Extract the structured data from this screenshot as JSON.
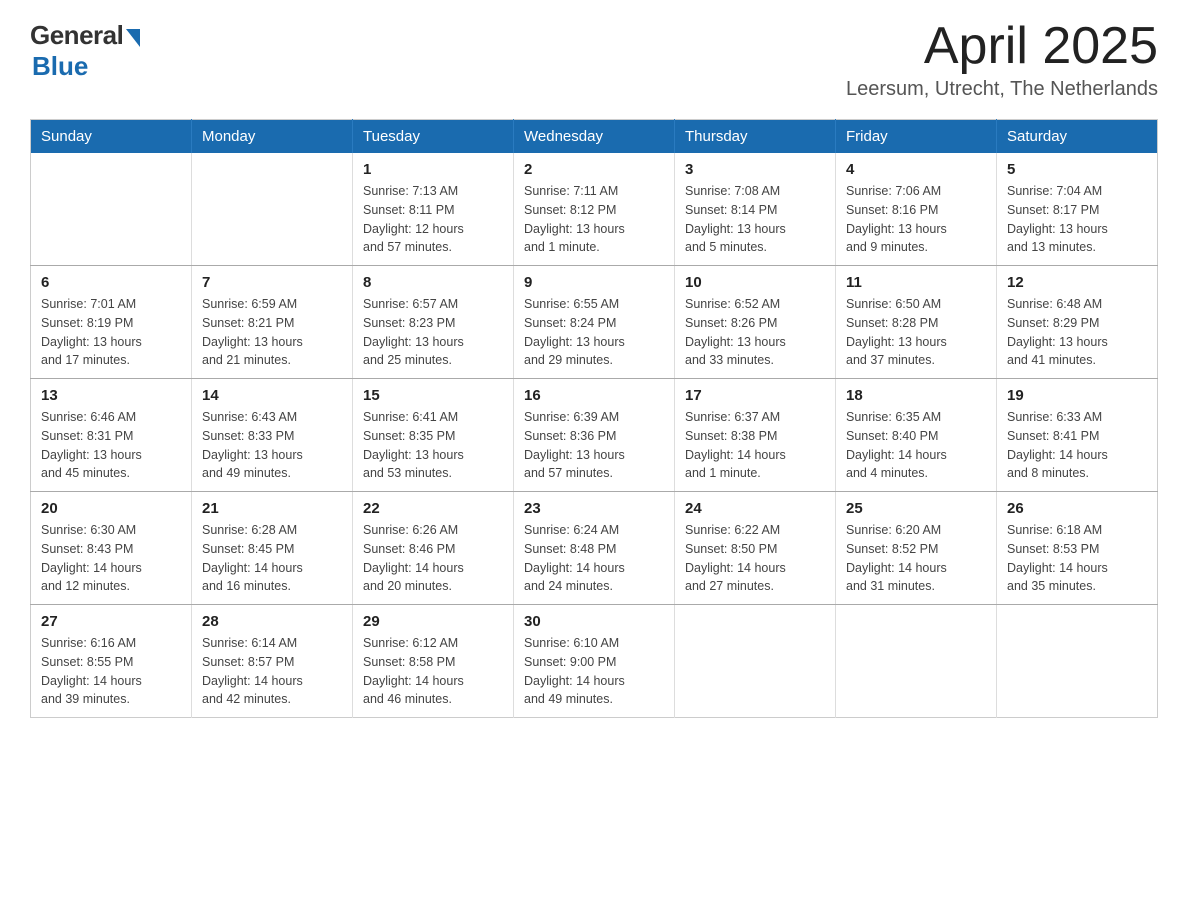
{
  "header": {
    "logo": {
      "general": "General",
      "blue": "Blue"
    },
    "title": "April 2025",
    "location": "Leersum, Utrecht, The Netherlands"
  },
  "calendar": {
    "days_of_week": [
      "Sunday",
      "Monday",
      "Tuesday",
      "Wednesday",
      "Thursday",
      "Friday",
      "Saturday"
    ],
    "weeks": [
      [
        {
          "day": "",
          "info": ""
        },
        {
          "day": "",
          "info": ""
        },
        {
          "day": "1",
          "info": "Sunrise: 7:13 AM\nSunset: 8:11 PM\nDaylight: 12 hours\nand 57 minutes."
        },
        {
          "day": "2",
          "info": "Sunrise: 7:11 AM\nSunset: 8:12 PM\nDaylight: 13 hours\nand 1 minute."
        },
        {
          "day": "3",
          "info": "Sunrise: 7:08 AM\nSunset: 8:14 PM\nDaylight: 13 hours\nand 5 minutes."
        },
        {
          "day": "4",
          "info": "Sunrise: 7:06 AM\nSunset: 8:16 PM\nDaylight: 13 hours\nand 9 minutes."
        },
        {
          "day": "5",
          "info": "Sunrise: 7:04 AM\nSunset: 8:17 PM\nDaylight: 13 hours\nand 13 minutes."
        }
      ],
      [
        {
          "day": "6",
          "info": "Sunrise: 7:01 AM\nSunset: 8:19 PM\nDaylight: 13 hours\nand 17 minutes."
        },
        {
          "day": "7",
          "info": "Sunrise: 6:59 AM\nSunset: 8:21 PM\nDaylight: 13 hours\nand 21 minutes."
        },
        {
          "day": "8",
          "info": "Sunrise: 6:57 AM\nSunset: 8:23 PM\nDaylight: 13 hours\nand 25 minutes."
        },
        {
          "day": "9",
          "info": "Sunrise: 6:55 AM\nSunset: 8:24 PM\nDaylight: 13 hours\nand 29 minutes."
        },
        {
          "day": "10",
          "info": "Sunrise: 6:52 AM\nSunset: 8:26 PM\nDaylight: 13 hours\nand 33 minutes."
        },
        {
          "day": "11",
          "info": "Sunrise: 6:50 AM\nSunset: 8:28 PM\nDaylight: 13 hours\nand 37 minutes."
        },
        {
          "day": "12",
          "info": "Sunrise: 6:48 AM\nSunset: 8:29 PM\nDaylight: 13 hours\nand 41 minutes."
        }
      ],
      [
        {
          "day": "13",
          "info": "Sunrise: 6:46 AM\nSunset: 8:31 PM\nDaylight: 13 hours\nand 45 minutes."
        },
        {
          "day": "14",
          "info": "Sunrise: 6:43 AM\nSunset: 8:33 PM\nDaylight: 13 hours\nand 49 minutes."
        },
        {
          "day": "15",
          "info": "Sunrise: 6:41 AM\nSunset: 8:35 PM\nDaylight: 13 hours\nand 53 minutes."
        },
        {
          "day": "16",
          "info": "Sunrise: 6:39 AM\nSunset: 8:36 PM\nDaylight: 13 hours\nand 57 minutes."
        },
        {
          "day": "17",
          "info": "Sunrise: 6:37 AM\nSunset: 8:38 PM\nDaylight: 14 hours\nand 1 minute."
        },
        {
          "day": "18",
          "info": "Sunrise: 6:35 AM\nSunset: 8:40 PM\nDaylight: 14 hours\nand 4 minutes."
        },
        {
          "day": "19",
          "info": "Sunrise: 6:33 AM\nSunset: 8:41 PM\nDaylight: 14 hours\nand 8 minutes."
        }
      ],
      [
        {
          "day": "20",
          "info": "Sunrise: 6:30 AM\nSunset: 8:43 PM\nDaylight: 14 hours\nand 12 minutes."
        },
        {
          "day": "21",
          "info": "Sunrise: 6:28 AM\nSunset: 8:45 PM\nDaylight: 14 hours\nand 16 minutes."
        },
        {
          "day": "22",
          "info": "Sunrise: 6:26 AM\nSunset: 8:46 PM\nDaylight: 14 hours\nand 20 minutes."
        },
        {
          "day": "23",
          "info": "Sunrise: 6:24 AM\nSunset: 8:48 PM\nDaylight: 14 hours\nand 24 minutes."
        },
        {
          "day": "24",
          "info": "Sunrise: 6:22 AM\nSunset: 8:50 PM\nDaylight: 14 hours\nand 27 minutes."
        },
        {
          "day": "25",
          "info": "Sunrise: 6:20 AM\nSunset: 8:52 PM\nDaylight: 14 hours\nand 31 minutes."
        },
        {
          "day": "26",
          "info": "Sunrise: 6:18 AM\nSunset: 8:53 PM\nDaylight: 14 hours\nand 35 minutes."
        }
      ],
      [
        {
          "day": "27",
          "info": "Sunrise: 6:16 AM\nSunset: 8:55 PM\nDaylight: 14 hours\nand 39 minutes."
        },
        {
          "day": "28",
          "info": "Sunrise: 6:14 AM\nSunset: 8:57 PM\nDaylight: 14 hours\nand 42 minutes."
        },
        {
          "day": "29",
          "info": "Sunrise: 6:12 AM\nSunset: 8:58 PM\nDaylight: 14 hours\nand 46 minutes."
        },
        {
          "day": "30",
          "info": "Sunrise: 6:10 AM\nSunset: 9:00 PM\nDaylight: 14 hours\nand 49 minutes."
        },
        {
          "day": "",
          "info": ""
        },
        {
          "day": "",
          "info": ""
        },
        {
          "day": "",
          "info": ""
        }
      ]
    ]
  }
}
